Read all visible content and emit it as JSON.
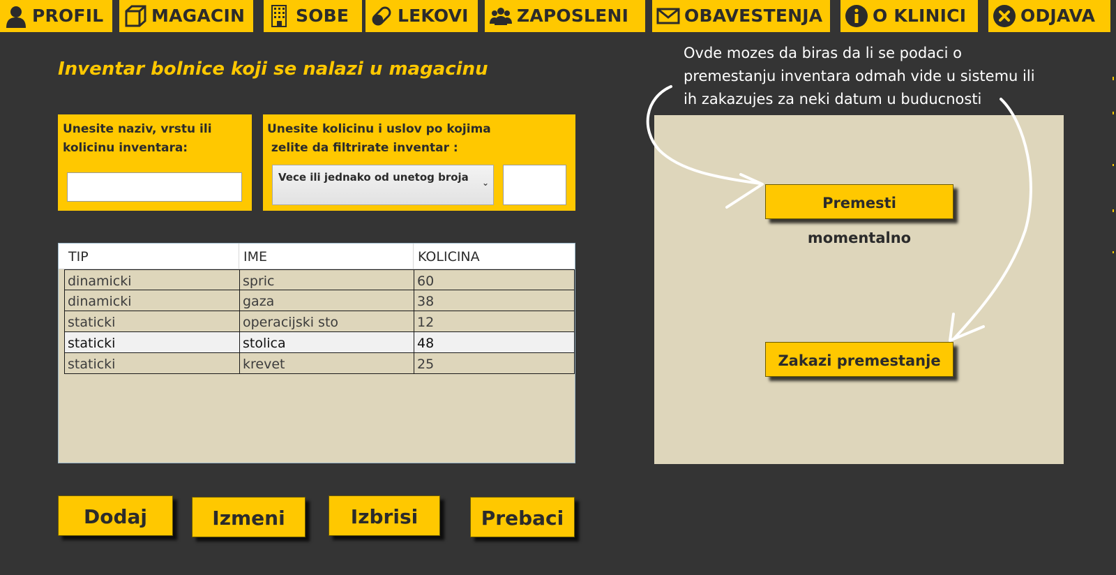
{
  "nav": {
    "items": [
      {
        "label": "PROFIL",
        "icon": "user-icon"
      },
      {
        "label": "MAGACIN",
        "icon": "box-icon"
      },
      {
        "label": "SOBE",
        "icon": "building-icon"
      },
      {
        "label": "LEKOVI",
        "icon": "pill-icon"
      },
      {
        "label": "ZAPOSLENI",
        "icon": "people-icon"
      },
      {
        "label": "OBAVESTENJA",
        "icon": "envelope-icon"
      },
      {
        "label": "O KLINICI",
        "icon": "info-icon"
      },
      {
        "label": "ODJAVA",
        "icon": "close-circle-icon"
      }
    ]
  },
  "page": {
    "title": "Inventar bolnice koji se nalazi u magacinu"
  },
  "filters": {
    "search_label_line1": "Unesite naziv, vrstu ili",
    "search_label_line2": "kolicinu inventara:",
    "search_value": "",
    "quantity_label_line1": "Unesite kolicinu i uslov po kojima",
    "quantity_label_line2": " zelite da filtrirate inventar :",
    "condition_selected": "Vece ili jednako od unetog broja",
    "quantity_value": ""
  },
  "table": {
    "columns": [
      "TIP",
      "IME",
      "KOLICINA"
    ],
    "rows": [
      {
        "tip": "dinamicki",
        "ime": "spric",
        "kolicina": "60"
      },
      {
        "tip": "dinamicki",
        "ime": "gaza",
        "kolicina": "38"
      },
      {
        "tip": "staticki",
        "ime": "operacijski sto",
        "kolicina": "12"
      },
      {
        "tip": "staticki",
        "ime": "stolica",
        "kolicina": "48"
      },
      {
        "tip": "staticki",
        "ime": "krevet",
        "kolicina": "25"
      }
    ],
    "selected_row": 3
  },
  "actions": {
    "add": "Dodaj",
    "edit": "Izmeni",
    "delete": "Izbrisi",
    "transfer": "Prebaci"
  },
  "move": {
    "help_line1": "Ovde mozes da biras da li se podaci o",
    "help_line2": "premestanju inventara odmah vide u sistemu ili",
    "help_line3": "ih zakazujes za neki datum u buducnosti",
    "move_now": "Premesti momentalno",
    "schedule_move": "Zakazi premestanje"
  },
  "colors": {
    "accent": "#ffc800",
    "background": "#343434",
    "panel": "#ded6bb",
    "text_dark": "#2b2b2b"
  }
}
